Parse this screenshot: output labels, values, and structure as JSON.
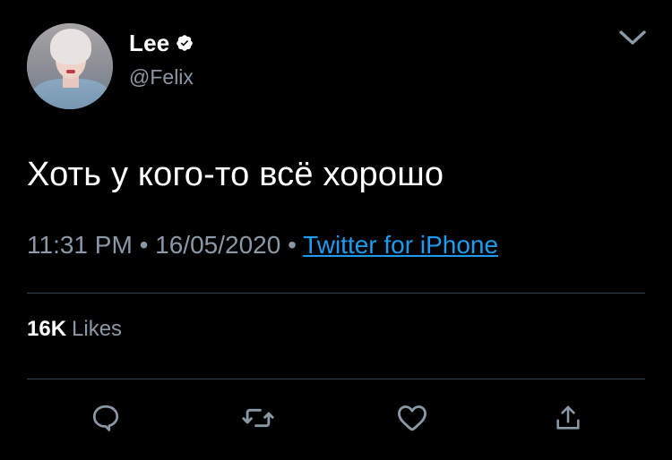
{
  "author": {
    "display_name": "Lee",
    "handle": "@Felix",
    "verified": true
  },
  "tweet": {
    "text": "Хоть у кого-то всё хорошо",
    "time": "11:31 PM",
    "separator": "•",
    "date": "16/05/2020",
    "source": "Twitter for iPhone"
  },
  "stats": {
    "likes_count": "16K",
    "likes_label": "Likes"
  },
  "actions": [
    "reply-icon",
    "retweet-icon",
    "like-icon",
    "share-icon"
  ],
  "colors": {
    "background": "#000000",
    "text_primary": "#ffffff",
    "text_secondary": "#8b98a5",
    "link": "#1d9bf0",
    "divider": "#38444d"
  }
}
